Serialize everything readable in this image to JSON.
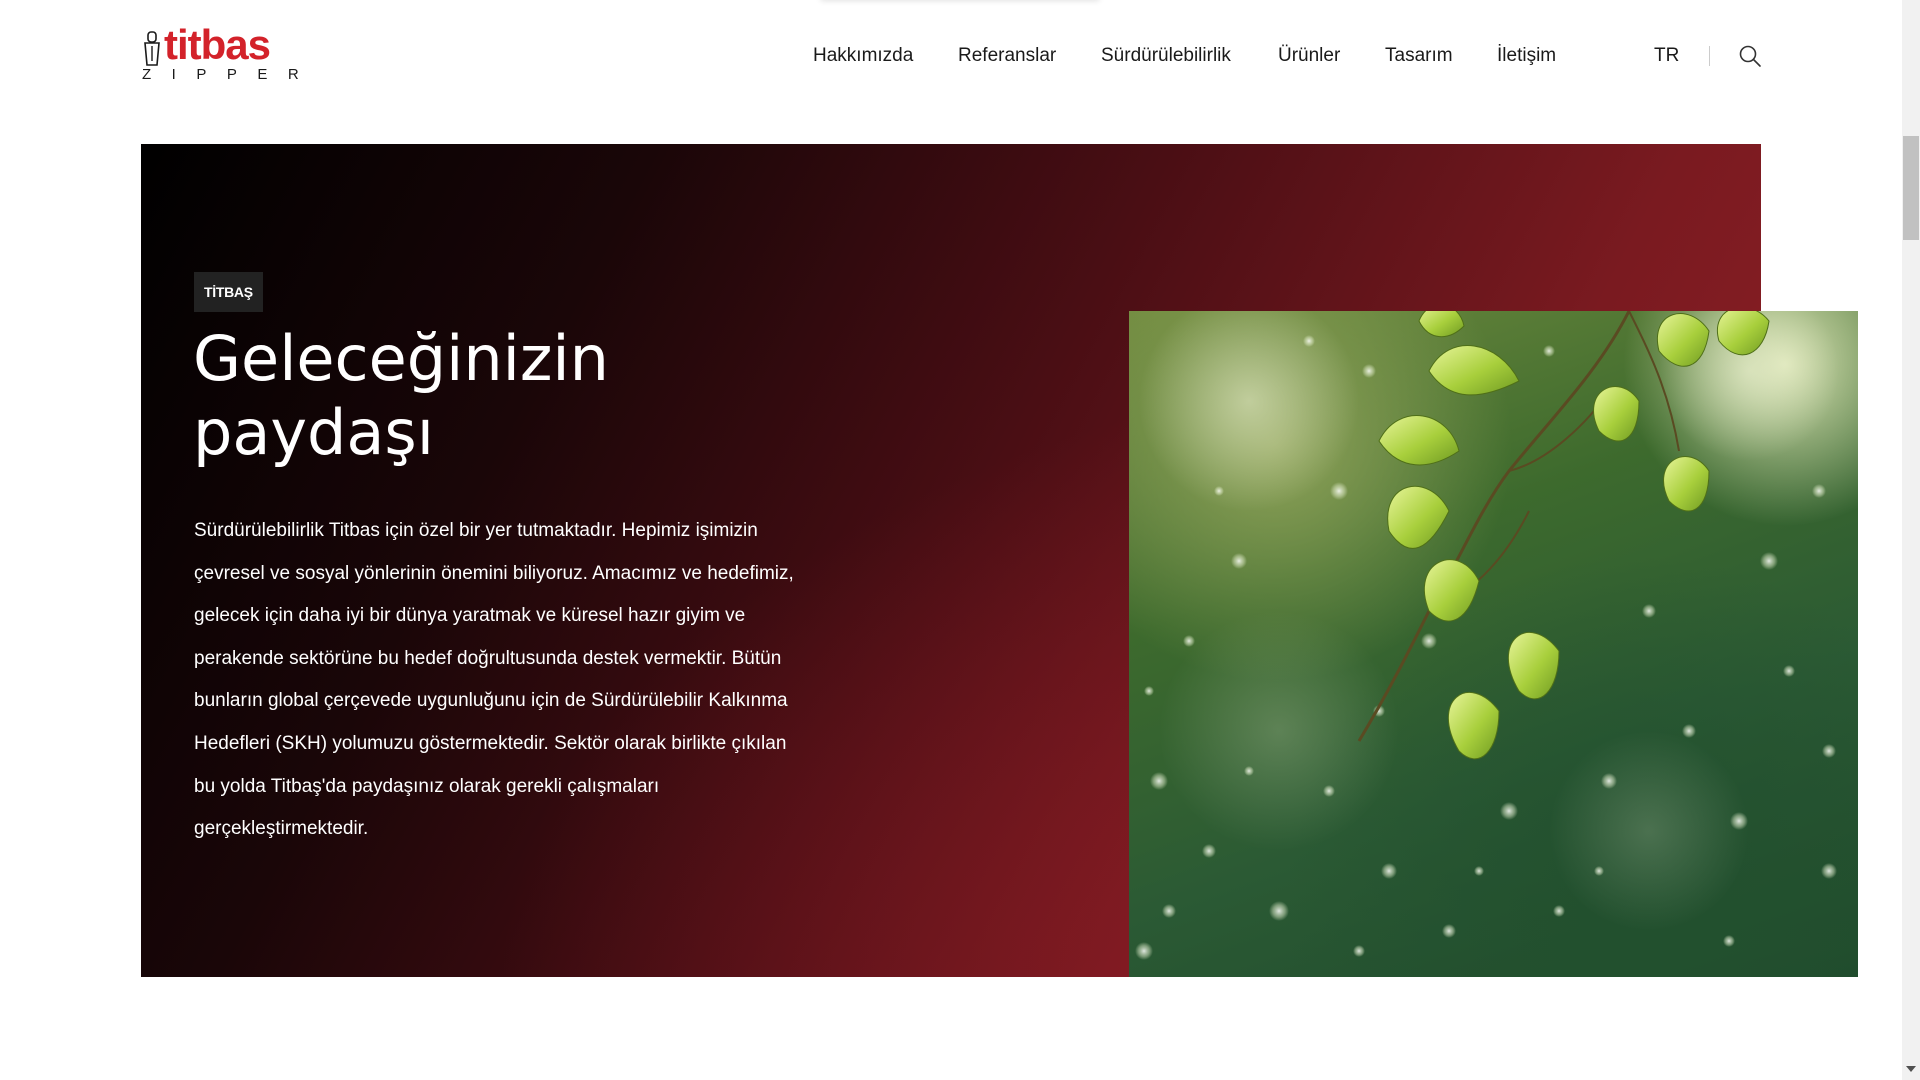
{
  "logo": {
    "word": "titbas",
    "sub": "ZIPPER"
  },
  "nav": {
    "items": [
      "Hakkımızda",
      "Referanslar",
      "Sürdürülebilirlik",
      "Ürünler",
      "Tasarım",
      "İletişim"
    ],
    "lang": "TR"
  },
  "hero": {
    "tag": "TİTBAŞ",
    "title_line1": "Geleceğinizin",
    "title_line2": "paydaşı",
    "body": "Sürdürülebilirlik Titbas için özel bir yer tutmaktadır. Hepimiz işimizin çevresel ve sosyal yönlerinin önemini biliyoruz. Amacımız ve hedefimiz, gelecek için daha iyi bir dünya yaratmak ve küresel hazır giyim ve perakende sektörüne bu hedef doğrultusunda destek vermektir. Bütün bunların global çerçevede uygunluğunu için de Sürdürülebilir Kalkınma Hedefleri (SKH) yolumuzu göstermektedir. Sektör olarak birlikte çıkılan bu yolda Titbaş'da paydaşınız olarak gerekli çalışmaları gerçekleştirmektedir."
  },
  "colors": {
    "brand_red": "#d3222a",
    "hero_dark": "#000000",
    "hero_red": "#932128"
  },
  "icons": {
    "search": "search-icon",
    "logo_mark": "zipper-icon"
  }
}
